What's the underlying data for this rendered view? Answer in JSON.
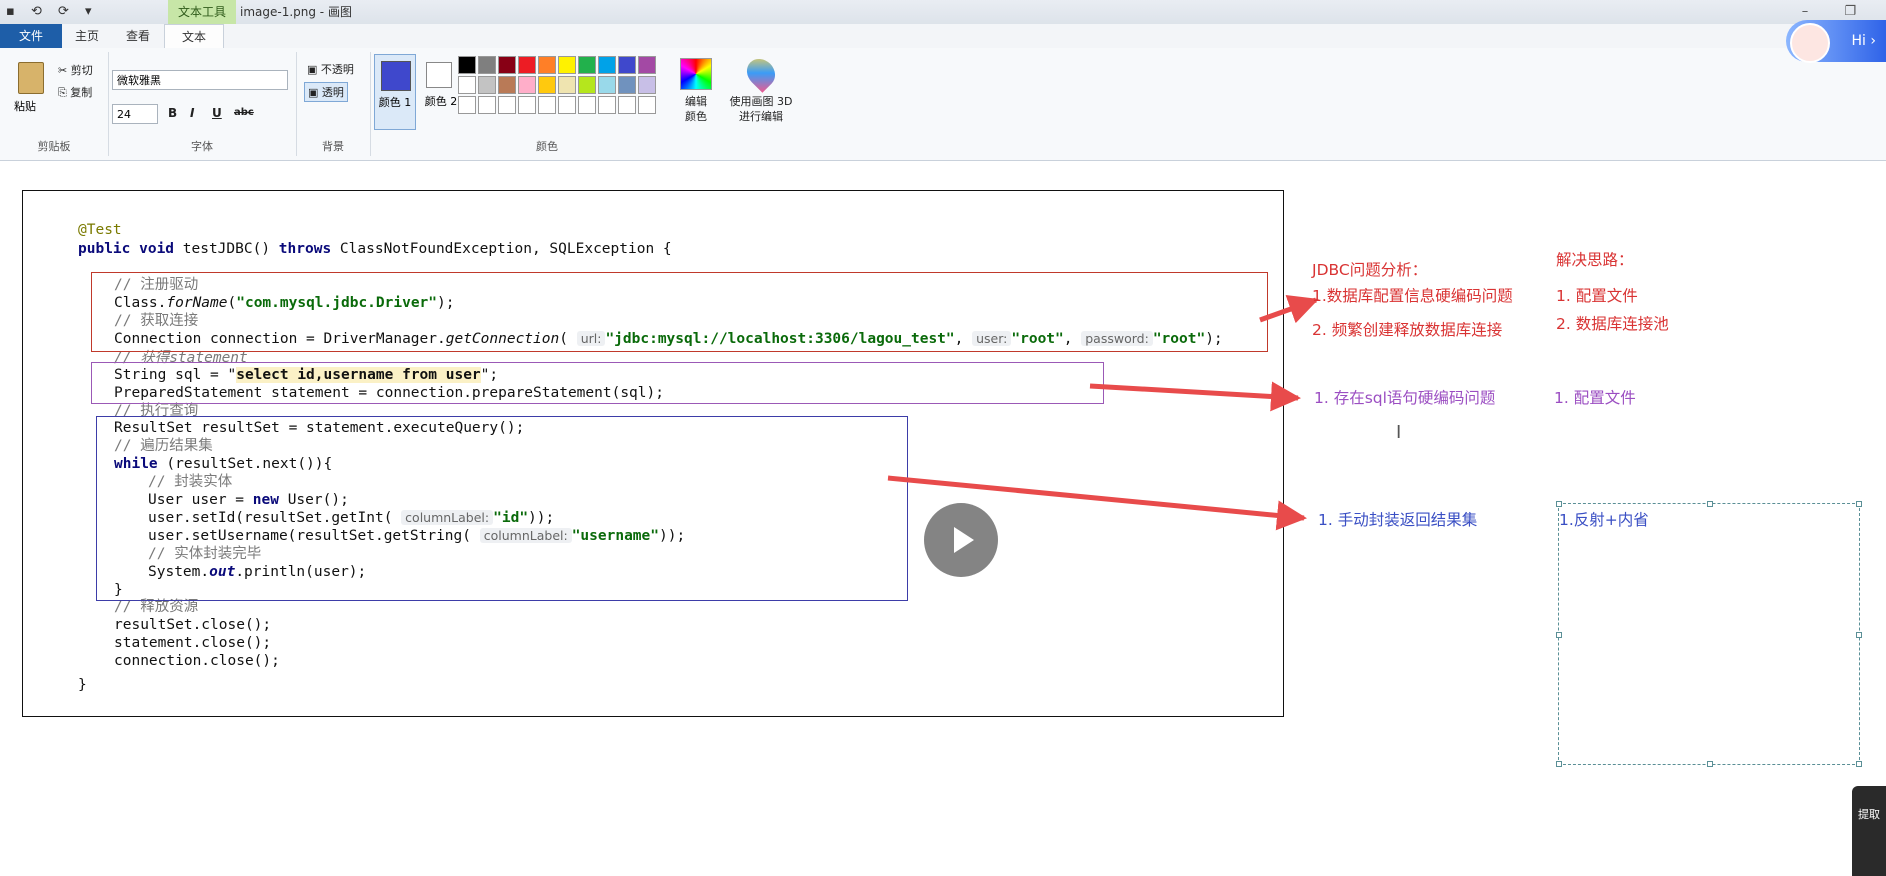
{
  "window": {
    "title": "image-1.png - 画图",
    "context_tab": "文本工具",
    "quick_access": "▪ ⟲ ⟳ ▾",
    "controls": "– ❐"
  },
  "tabs": [
    "文件",
    "主页",
    "查看",
    "文本"
  ],
  "ribbon": {
    "clipboard": {
      "paste": "粘贴",
      "cut": "剪切",
      "copy": "复制",
      "label": "剪贴板"
    },
    "font": {
      "family": "微软雅黑",
      "size": "24",
      "bold": "B",
      "italic": "I",
      "underline": "U",
      "strike": "abc",
      "label": "字体"
    },
    "background": {
      "opaque": "不透明",
      "transparent": "透明",
      "label": "背景"
    },
    "colors": {
      "color1": "颜色 1",
      "color2": "颜色 2",
      "edit": "编辑颜色",
      "paint3d": "使用画图 3D 进行编辑",
      "label": "颜色",
      "palette": [
        "#000000",
        "#7f7f7f",
        "#880015",
        "#ed1c24",
        "#ff7f27",
        "#fff200",
        "#22b14c",
        "#00a2e8",
        "#3f48cc",
        "#a349a4",
        "#ffffff",
        "#c3c3c3",
        "#b97a57",
        "#ffaec9",
        "#ffc90e",
        "#efe4b0",
        "#b5e61d",
        "#99d9ea",
        "#7092be",
        "#c8bfe7",
        "#ffffff",
        "#ffffff",
        "#ffffff",
        "#ffffff",
        "#ffffff",
        "#ffffff",
        "#ffffff",
        "#ffffff",
        "#ffffff",
        "#ffffff"
      ]
    }
  },
  "code": {
    "annotation": "@Test",
    "signature_kw1": "public void",
    "signature_name": " testJDBC() ",
    "signature_kw2": "throws",
    "signature_rest": " ClassNotFoundException, SQLException {",
    "c_register": "// 注册驱动",
    "class_forname_pre": "Class.",
    "class_forname_it": "forName",
    "class_forname_arg": "\"com.mysql.jdbc.Driver\"",
    "class_forname_end": ");",
    "c_getconn": "// 获取连接",
    "conn_pre": "Connection connection = DriverManager.",
    "conn_method": "getConnection",
    "hint_url": "url:",
    "conn_url": "\"jdbc:mysql://localhost:3306/lagou_test\"",
    "hint_user": "user:",
    "conn_user": "\"root\"",
    "hint_password": "password:",
    "conn_password": "\"root\"",
    "conn_end": ");",
    "c_statement": "// 获得statement",
    "sql_pre": "String sql = \"",
    "sql_value": "select id,username from user",
    "sql_end": "\";",
    "prep": "PreparedStatement statement = connection.prepareStatement(sql);",
    "c_exec": "// 执行查询",
    "rs": "ResultSet resultSet = statement.executeQuery();",
    "c_iter": "// 遍历结果集",
    "while_kw": "while",
    "while_rest": " (resultSet.next()){",
    "c_wrap": "// 封装实体",
    "user_pre": "User user = ",
    "new_kw": "new",
    "user_rest": " User();",
    "setid_pre": "user.setId(resultSet.getInt(",
    "hint_col": "columnLabel:",
    "setid_arg": "\"id\"",
    "setid_end": "));",
    "setname_pre": "user.setUsername(resultSet.getString(",
    "setname_arg": "\"username\"",
    "setname_end": "));",
    "c_done": "// 实体封装完毕",
    "print_pre": "System.",
    "print_out": "out",
    "print_rest": ".println(user);",
    "close_brace_inner": "}",
    "c_release": "// 释放资源",
    "close1": "resultSet.close();",
    "close2": "statement.close();",
    "close3": "connection.close();",
    "close_brace": "}"
  },
  "notes": {
    "analysis_title": "JDBC问题分析：",
    "solution_title": "解决思路：",
    "p1": "1.数据库配置信息硬编码问题",
    "p2": "2. 频繁创建释放数据库连接",
    "s1": "1. 配置文件",
    "s2": "2. 数据库连接池",
    "p3": "1. 存在sql语句硬编码问题",
    "s3": "1. 配置文件",
    "p4": "1. 手动封装返回结果集",
    "s4": "1.反射+内省"
  },
  "overlay": {
    "hi": "Hi ›",
    "side_tool": "提取"
  }
}
